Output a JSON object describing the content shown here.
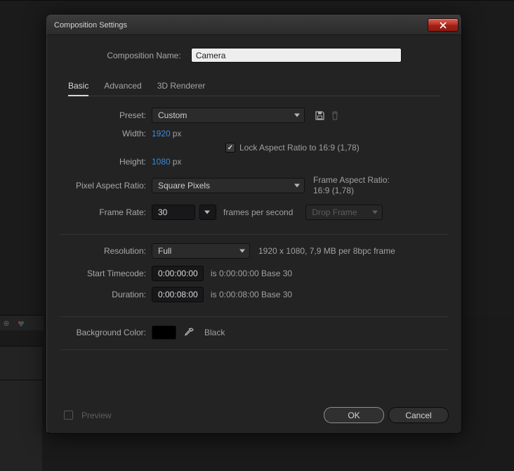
{
  "dialog": {
    "title": "Composition Settings",
    "composition_name_label": "Composition Name:",
    "composition_name_value": "Camera",
    "tabs": {
      "basic": "Basic",
      "advanced": "Advanced",
      "renderer": "3D Renderer"
    },
    "preset": {
      "label": "Preset:",
      "value": "Custom"
    },
    "dims": {
      "width_label": "Width:",
      "width_value": "1920",
      "height_label": "Height:",
      "height_value": "1080",
      "unit": "px",
      "lock_label": "Lock Aspect Ratio to 16:9 (1,78)"
    },
    "par": {
      "label": "Pixel Aspect Ratio:",
      "value": "Square Pixels",
      "frame_aspect_label": "Frame Aspect Ratio:",
      "frame_aspect_value": "16:9 (1,78)"
    },
    "fps": {
      "label": "Frame Rate:",
      "value": "30",
      "suffix": "frames per second",
      "drop": "Drop Frame"
    },
    "res": {
      "label": "Resolution:",
      "value": "Full",
      "info": "1920 x 1080, 7,9 MB per 8bpc frame"
    },
    "start": {
      "label": "Start Timecode:",
      "value": "0:00:00:00",
      "info": "is 0:00:00:00  Base 30"
    },
    "dur": {
      "label": "Duration:",
      "value": "0:00:08:00",
      "info": "is 0:00:08:00  Base 30"
    },
    "bg": {
      "label": "Background Color:",
      "name": "Black",
      "hex": "#000000"
    },
    "footer": {
      "preview": "Preview",
      "ok": "OK",
      "cancel": "Cancel"
    }
  }
}
